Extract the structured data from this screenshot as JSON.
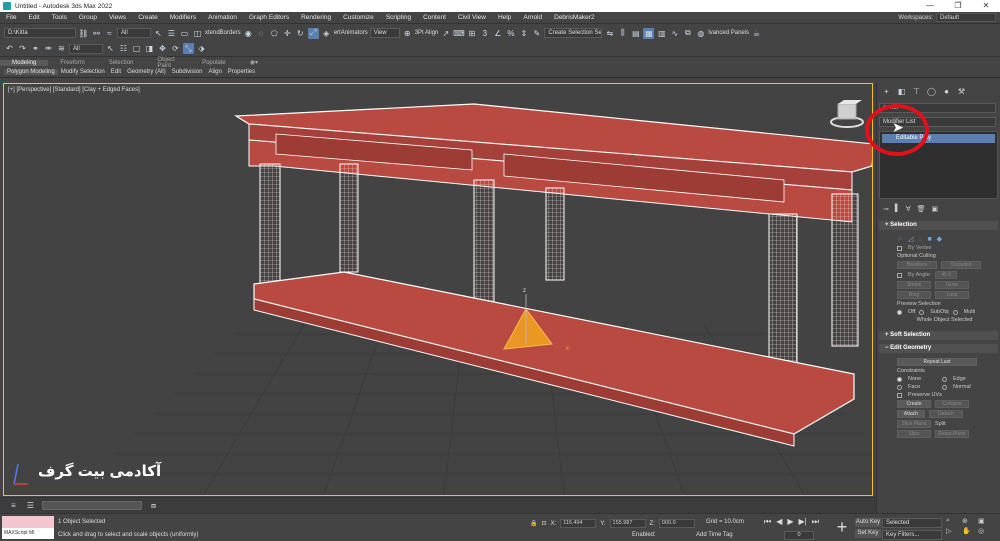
{
  "window": {
    "title": "Untitled - Autodesk 3ds Max 2022",
    "controls": [
      "—",
      "❐",
      "✕"
    ]
  },
  "menu": {
    "items": [
      "File",
      "Edit",
      "Tools",
      "Group",
      "Views",
      "Create",
      "Modifiers",
      "Animation",
      "Graph Editors",
      "Rendering",
      "Customize",
      "Scripting",
      "Content",
      "Civil View",
      "Help",
      "Arnold",
      "DebrisMaker2"
    ],
    "workspaces_label": "Workspaces:",
    "workspaces_value": "Default"
  },
  "toolbar": {
    "project_path": "D:\\Kitta",
    "selection_filter": "All",
    "extended_borders": "xtendBorders",
    "anim_label": "ertAnimators",
    "ref_coord": "View",
    "threept_align": "3Pt Align",
    "create_selection_set": "Create Selection Se",
    "advanced_panels": "lvanced Panels"
  },
  "ribbon": {
    "tabs": [
      "Modeling",
      "Freeform",
      "Selection",
      "Object Paint",
      "Populate"
    ],
    "items": [
      "Polygon Modeling",
      "Modify Selection",
      "Edit",
      "Geometry (All)",
      "Subdivision",
      "Align",
      "Properties"
    ]
  },
  "viewport": {
    "label": "[+] [Perspective] [Standard] [Clay + Edged Faces]",
    "watermark": "آکادمی بیت گرف",
    "axis_z": "z",
    "axis_x": "x"
  },
  "command_panel": {
    "object_name": "ormel",
    "modifier_list": "Modifier List",
    "stack_item": "Editable Poly",
    "selection": {
      "header": "Selection",
      "by_vertex": "By Vertex",
      "optional_culling": "Optional Culling",
      "backface": "Backface",
      "occluded": "Occluded",
      "by_angle": "By Angle:",
      "by_angle_value": "45.0",
      "shrink": "Shrink",
      "grow": "Grow",
      "ring": "Ring",
      "loop": "Loop",
      "preview_selection": "Preview Selection",
      "off": "Off",
      "subobj": "SubObj",
      "multi": "Multi",
      "whole_object": "Whole Object Selected"
    },
    "soft_selection": {
      "header": "Soft Selection"
    },
    "edit_geometry": {
      "header": "Edit Geometry",
      "repeat_last": "Repeat Last",
      "constraints": "Constraints",
      "none": "None",
      "edge": "Edge",
      "face": "Face",
      "normal": "Normal",
      "preserve_uvs": "Preserve UVs",
      "create": "Create",
      "collapse": "Collapse",
      "attach": "Attach",
      "detach": "Detach",
      "slice_plane": "Slice Plane",
      "split": "Split",
      "slice": "Slice",
      "reset_plane": "Reset Plane"
    }
  },
  "status": {
    "maxscript": "MAXScript Mi:",
    "objects_selected": "1 Object Selected",
    "prompt": "Click and drag to select and scale objects (uniformly)",
    "x_label": "X:",
    "x_value": "116.494",
    "y_label": "Y:",
    "y_value": "155.987",
    "z_label": "Z:",
    "z_value": "000.0",
    "grid": "Grid = 10.0cm",
    "enabled": "Enabled:",
    "add_time_tag": "Add Time Tag",
    "frame": "0",
    "auto_key": "Auto Key",
    "set_key": "Set Key",
    "selected": "Selected",
    "key_filters": "Key Filters..."
  },
  "colors": {
    "viewport_bg": "#434343",
    "model_fill": "#b94a42",
    "active_blue": "#5b7fb0",
    "highlight_red": "#e0111a"
  }
}
